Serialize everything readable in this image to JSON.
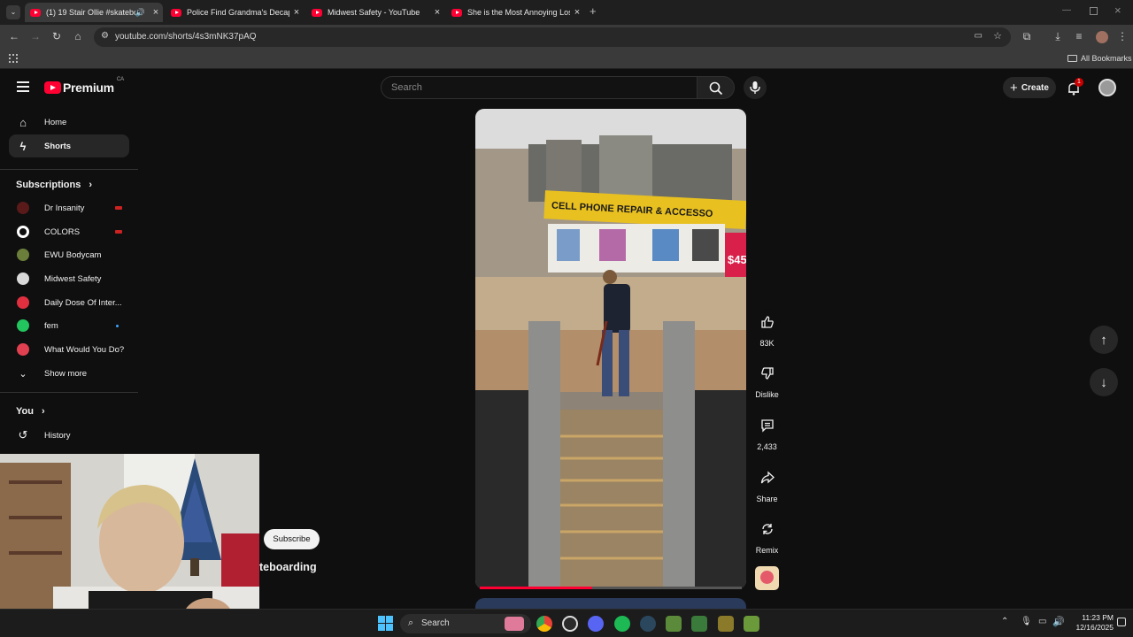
{
  "browser": {
    "tabs": [
      {
        "title": "(1) 19 Stair Ollie #skateboa",
        "active": true,
        "audio": true
      },
      {
        "title": "Police Find Grandma's Decapita",
        "active": false
      },
      {
        "title": "Midwest Safety - YouTube",
        "active": false
      },
      {
        "title": "She is the Most Annoying Lose",
        "active": false
      }
    ],
    "new_tab_symbol": "+",
    "url": "youtube.com/shorts/4s3mNK37pAQ",
    "bookmarks_label": "All Bookmarks"
  },
  "youtube": {
    "logo_text": "Premium",
    "region": "CA",
    "search_placeholder": "Search",
    "create_label": "Create",
    "notification_count": "1"
  },
  "sidebar": {
    "nav": [
      {
        "label": "Home",
        "icon": "home-icon"
      },
      {
        "label": "Shorts",
        "icon": "shorts-icon",
        "active": true
      }
    ],
    "subscriptions_header": "Subscriptions",
    "subscriptions": [
      {
        "name": "Dr Insanity",
        "indicator": "live",
        "avatar_color": "#5a1a1a"
      },
      {
        "name": "COLORS",
        "indicator": "live",
        "avatar_color": "#ffffff"
      },
      {
        "name": "EWU Bodycam",
        "indicator": "none",
        "avatar_color": "#6b7f3a"
      },
      {
        "name": "Midwest Safety",
        "indicator": "none",
        "avatar_color": "#d9d9d9"
      },
      {
        "name": "Daily Dose Of Inter...",
        "indicator": "none",
        "avatar_color": "#e03040"
      },
      {
        "name": "fem",
        "indicator": "new",
        "avatar_color": "#22c55e"
      },
      {
        "name": "What Would You Do?",
        "indicator": "none",
        "avatar_color": "#e04050"
      }
    ],
    "show_more": "Show more",
    "you_header": "You",
    "history": "History"
  },
  "short": {
    "progress_fraction": 0.43,
    "video_sign_text": "CELL PHONE REPAIR & ACCESSO",
    "price_tag": "$45",
    "subscribe_label": "Subscribe",
    "channel_title_partial": "teboarding"
  },
  "actions": {
    "likes": "83K",
    "dislike_label": "Dislike",
    "comments": "2,433",
    "share_label": "Share",
    "remix_label": "Remix"
  },
  "taskbar": {
    "search_label": "Search",
    "time": "11:23 PM",
    "date": "12/16/2025"
  }
}
